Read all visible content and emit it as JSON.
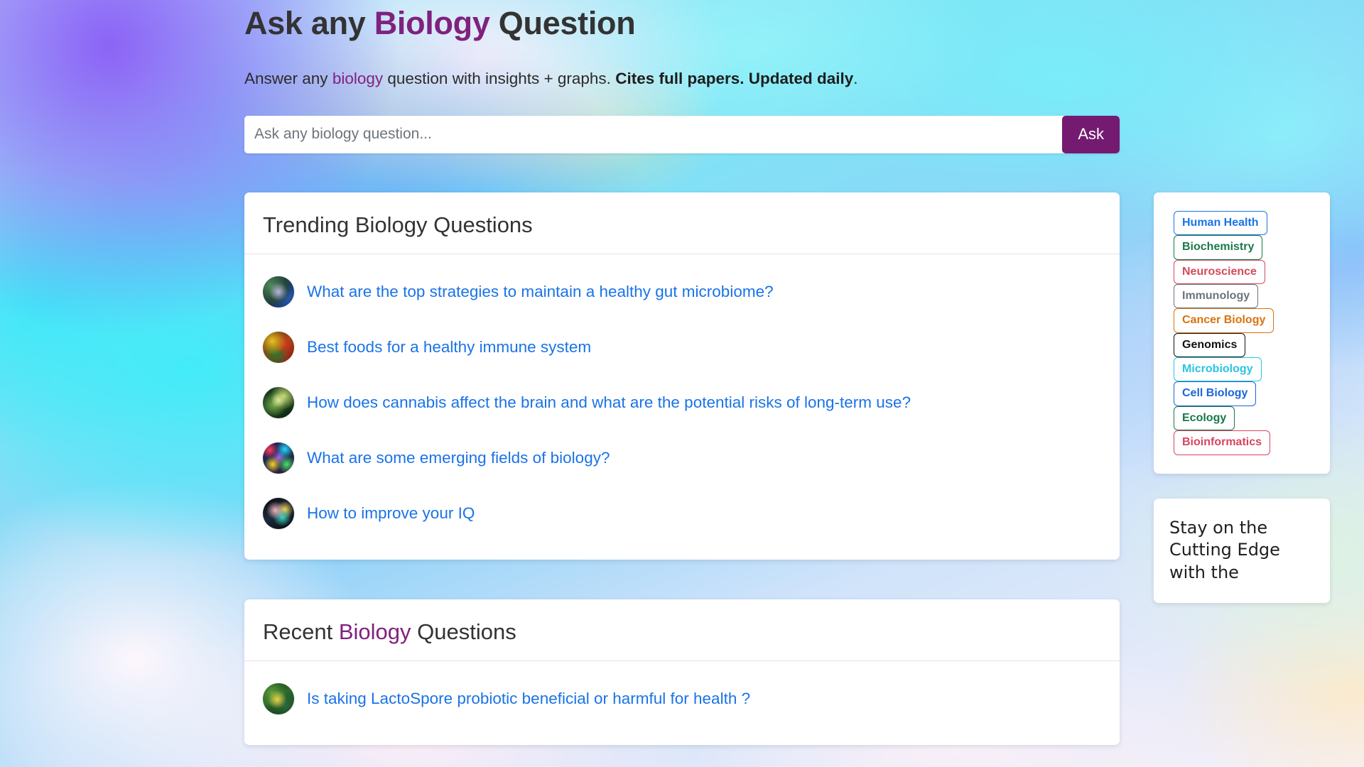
{
  "theme": {
    "accent_purple": "#80217F",
    "button_purple": "#741b71",
    "link_blue": "#1a73e8",
    "heading_gray": "#333333"
  },
  "hero": {
    "title_part1": "Ask any ",
    "title_accent": "Biology",
    "title_part3": " Question",
    "subtitle_part1": "Answer any ",
    "subtitle_accent": "biology",
    "subtitle_part3": " question with insights + graphs. ",
    "subtitle_bold": "Cites full papers. Updated daily",
    "subtitle_end": "."
  },
  "search": {
    "placeholder": "Ask any biology question...",
    "value": "",
    "button_label": "Ask"
  },
  "trending": {
    "heading": "Trending Biology Questions",
    "questions": [
      {
        "text": "What are the top strategies to maintain a healthy gut microbiome?",
        "thumb": "gut-microbiome-thumbnail"
      },
      {
        "text": "Best foods for a healthy immune system",
        "thumb": "healthy-foods-thumbnail"
      },
      {
        "text": "How does cannabis affect the brain and what are the potential risks of long-term use?",
        "thumb": "cannabis-brain-thumbnail"
      },
      {
        "text": "What are some emerging fields of biology?",
        "thumb": "emerging-fields-thumbnail"
      },
      {
        "text": "How to improve your IQ",
        "thumb": "brain-iq-thumbnail"
      }
    ]
  },
  "recent": {
    "heading_part1": "Recent ",
    "heading_accent": "Biology",
    "heading_part3": " Questions",
    "questions": [
      {
        "text": "Is taking LactoSpore probiotic beneficial or harmful for health ?",
        "thumb": "probiotic-thumbnail"
      }
    ]
  },
  "sidebar": {
    "tags": [
      {
        "label": "Human Health",
        "color": "#1a73e8"
      },
      {
        "label": "Biochemistry",
        "color": "#1a7a4a"
      },
      {
        "label": "Neuroscience",
        "color": "#d34a5c"
      },
      {
        "label": "Immunology",
        "color": "#6c757d"
      },
      {
        "label": "Cancer Biology",
        "color": "#d9730d"
      },
      {
        "label": "Genomics",
        "color": "#111111"
      },
      {
        "label": "Microbiology",
        "color": "#2ac5e0"
      },
      {
        "label": "Cell Biology",
        "color": "#1a66d8"
      },
      {
        "label": "Ecology",
        "color": "#17794a"
      },
      {
        "label": "Bioinformatics",
        "color": "#d9455f"
      }
    ],
    "promo": {
      "text": "Stay on the Cutting Edge with the"
    }
  }
}
